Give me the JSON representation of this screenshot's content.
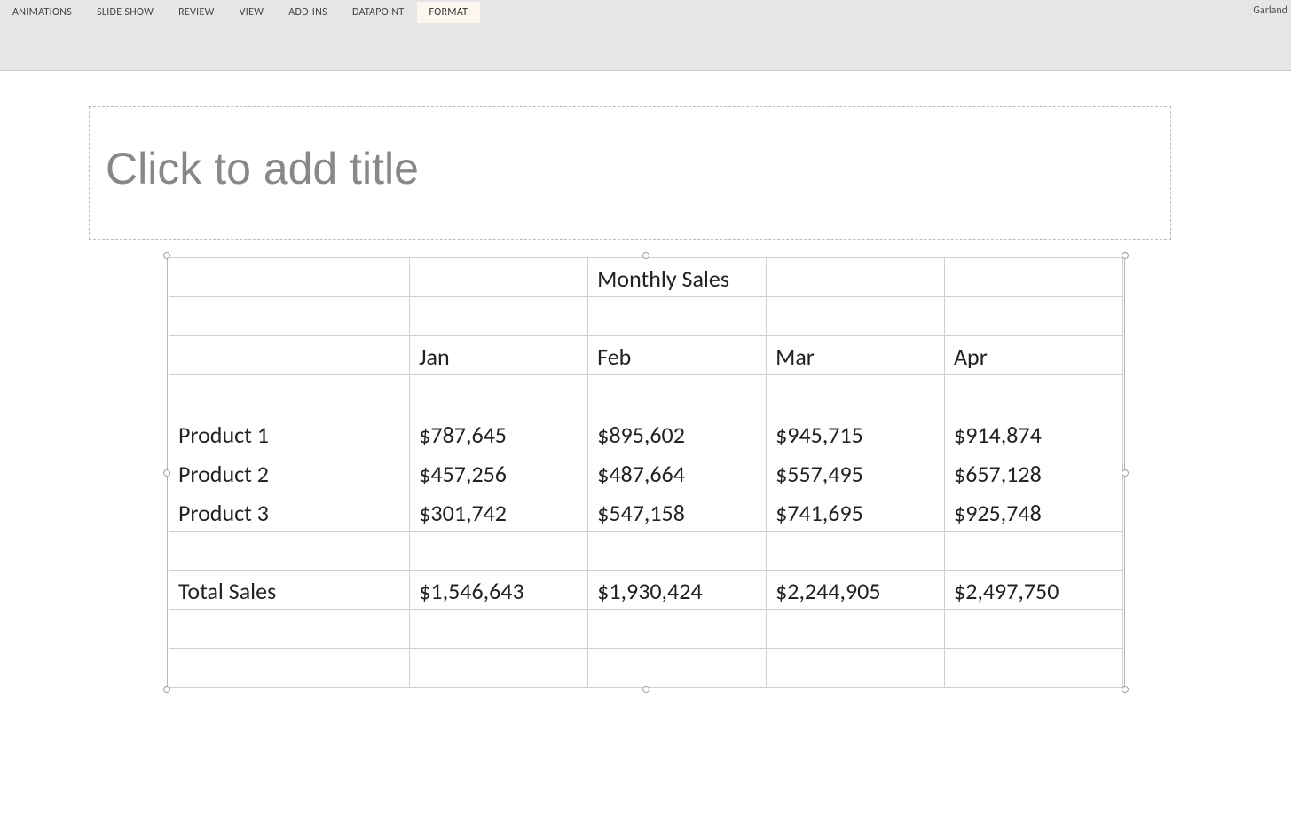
{
  "ribbon": {
    "tabs": [
      "ANIMATIONS",
      "SLIDE SHOW",
      "REVIEW",
      "VIEW",
      "ADD-INS",
      "DATAPOINT",
      "FORMAT"
    ],
    "active_tab": "FORMAT",
    "user": "Garland"
  },
  "slide": {
    "title_placeholder": "Click to add title"
  },
  "table": {
    "title": "Monthly Sales",
    "months": [
      "Jan",
      "Feb",
      "Mar",
      "Apr"
    ],
    "rows": [
      {
        "label": "Product 1",
        "values": [
          "$787,645",
          "$895,602",
          "$945,715",
          "$914,874"
        ]
      },
      {
        "label": "Product 2",
        "values": [
          "$457,256",
          "$487,664",
          "$557,495",
          "$657,128"
        ]
      },
      {
        "label": "Product 3",
        "values": [
          "$301,742",
          "$547,158",
          "$741,695",
          "$925,748"
        ]
      }
    ],
    "total": {
      "label": "Total Sales",
      "values": [
        "$1,546,643",
        "$1,930,424",
        "$2,244,905",
        "$2,497,750"
      ]
    }
  },
  "chart_data": {
    "type": "table",
    "title": "Monthly Sales",
    "categories": [
      "Jan",
      "Feb",
      "Mar",
      "Apr"
    ],
    "series": [
      {
        "name": "Product 1",
        "values": [
          787645,
          895602,
          945715,
          914874
        ]
      },
      {
        "name": "Product 2",
        "values": [
          457256,
          487664,
          557495,
          657128
        ]
      },
      {
        "name": "Product 3",
        "values": [
          301742,
          547158,
          741695,
          925748
        ]
      },
      {
        "name": "Total Sales",
        "values": [
          1546643,
          1930424,
          2244905,
          2497750
        ]
      }
    ]
  }
}
